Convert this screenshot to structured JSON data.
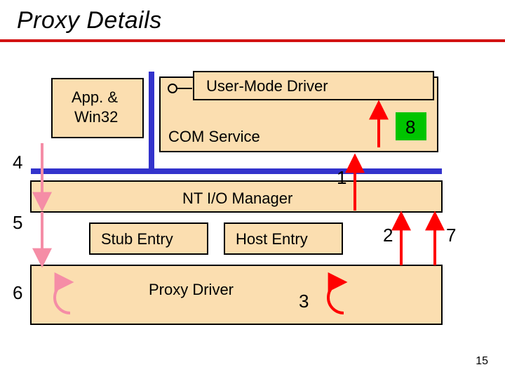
{
  "title": "Proxy Details",
  "boxes": {
    "app": {
      "line1": "App. &",
      "line2": "Win32"
    },
    "user_mode": "User-Mode Driver",
    "com_service": "COM Service",
    "io_manager": "NT I/O Manager",
    "stub_entry": "Stub Entry",
    "host_entry": "Host Entry",
    "proxy_driver": "Proxy Driver"
  },
  "numbers": {
    "n1": "1",
    "n2": "2",
    "n3": "3",
    "n4": "4",
    "n5": "5",
    "n6": "6",
    "n7": "7",
    "n8": "8"
  },
  "slide_number": "15",
  "colors": {
    "peach": "#fbdeb0",
    "blue": "#3333cc",
    "red": "#ff0000",
    "pink": "#f58da6",
    "pink_dark": "#e35a7d",
    "green": "#00c400"
  }
}
